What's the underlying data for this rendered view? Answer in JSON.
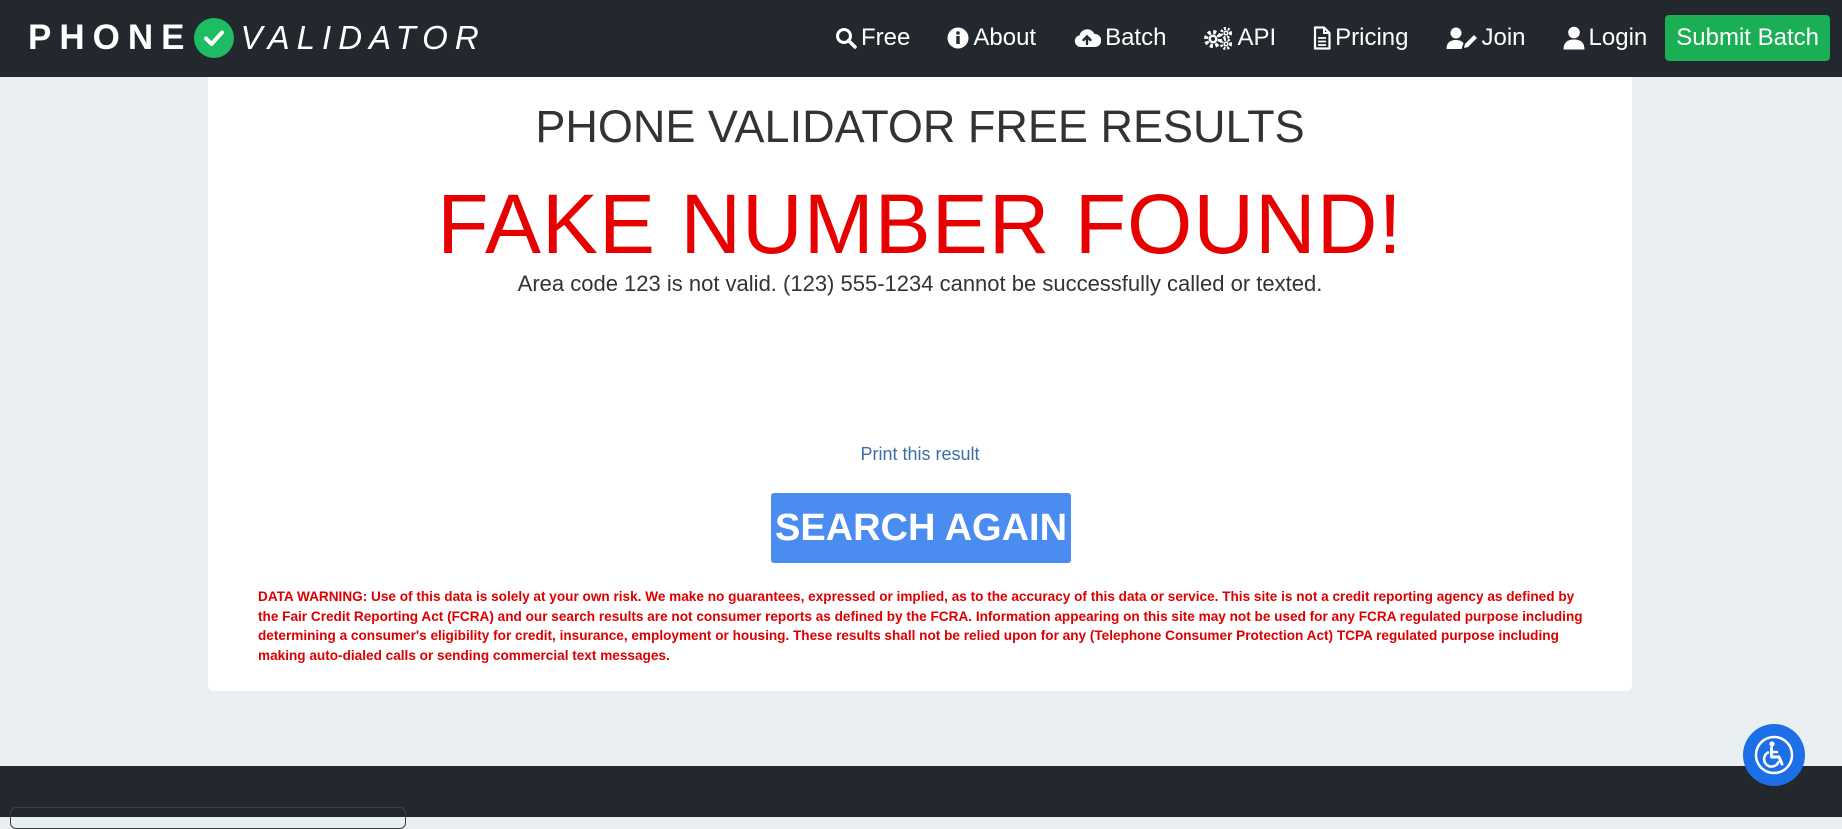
{
  "brand": {
    "word1": "PHONE",
    "word2": "VALIDATOR",
    "accent_color": "#1ebd63"
  },
  "nav": {
    "items": [
      {
        "label": "Free",
        "icon": "search-icon"
      },
      {
        "label": "About",
        "icon": "info-circle-icon"
      },
      {
        "label": "Batch",
        "icon": "cloud-upload-icon"
      },
      {
        "label": "API",
        "icon": "gears-icon"
      },
      {
        "label": "Pricing",
        "icon": "document-icon"
      },
      {
        "label": "Join",
        "icon": "user-edit-icon"
      },
      {
        "label": "Login",
        "icon": "user-icon"
      }
    ],
    "cta_label": "Submit Batch",
    "cta_color": "#1aae55"
  },
  "main": {
    "title": "PHONE VALIDATOR FREE RESULTS",
    "result_heading": "FAKE NUMBER FOUND!",
    "result_color": "#e60000",
    "result_detail": "Area code 123 is not valid. (123) 555-1234 cannot be successfully called or texted.",
    "print_link": "Print this result",
    "search_again": "SEARCH AGAIN",
    "warning": "DATA WARNING: Use of this data is solely at your own risk. We make no guarantees, expressed or implied, as to the accuracy of this data or service. This site is not a credit reporting agency as defined by the Fair Credit Reporting Act (FCRA) and our search results are not consumer reports as defined by the FCRA. Information appearing on this site may not be used for any FCRA regulated purpose including determining a consumer's eligibility for credit, insurance, employment or housing. These results shall not be relied upon for any (Telephone Consumer Protection Act) TCPA regulated purpose including making auto-dialed calls or sending commercial text messages."
  },
  "accessibility": {
    "icon": "wheelchair-icon",
    "color": "#1d6fe8"
  }
}
